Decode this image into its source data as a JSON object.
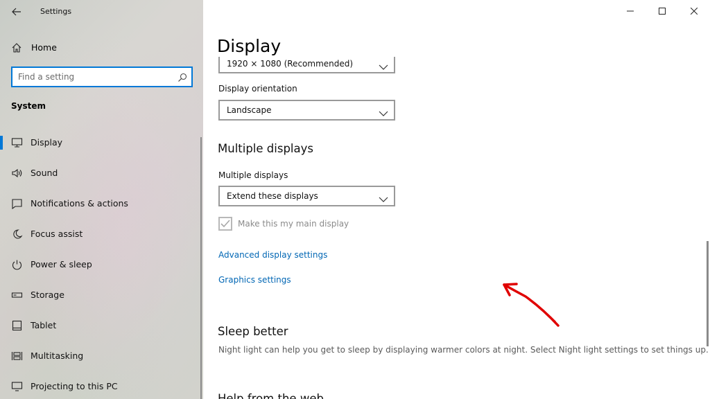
{
  "window": {
    "title": "Settings"
  },
  "sidebar": {
    "home_label": "Home",
    "search": {
      "placeholder": "Find a setting",
      "value": ""
    },
    "section_label": "System",
    "items": [
      {
        "label": "Display",
        "icon": "monitor-icon",
        "active": true
      },
      {
        "label": "Sound",
        "icon": "speaker-icon"
      },
      {
        "label": "Notifications & actions",
        "icon": "notification-icon"
      },
      {
        "label": "Focus assist",
        "icon": "moon-icon"
      },
      {
        "label": "Power & sleep",
        "icon": "power-icon"
      },
      {
        "label": "Storage",
        "icon": "storage-icon"
      },
      {
        "label": "Tablet",
        "icon": "tablet-icon"
      },
      {
        "label": "Multitasking",
        "icon": "multitasking-icon"
      },
      {
        "label": "Projecting to this PC",
        "icon": "projecting-icon"
      }
    ]
  },
  "main": {
    "title": "Display",
    "resolution_dropdown": {
      "value": "1920 × 1080 (Recommended)"
    },
    "orientation": {
      "label": "Display orientation",
      "value": "Landscape"
    },
    "multiple_displays": {
      "heading": "Multiple displays",
      "label": "Multiple displays",
      "value": "Extend these displays",
      "checkbox_label": "Make this my main display",
      "checkbox_checked": true,
      "checkbox_disabled": true
    },
    "links": {
      "advanced": "Advanced display settings",
      "graphics": "Graphics settings"
    },
    "sleep": {
      "heading": "Sleep better",
      "description": "Night light can help you get to sleep by displaying warmer colors at night. Select Night light settings to set things up."
    },
    "help_heading": "Help from the web"
  },
  "colors": {
    "accent": "#0078d7",
    "link": "#0066b4",
    "annotation_arrow": "#e00000"
  }
}
